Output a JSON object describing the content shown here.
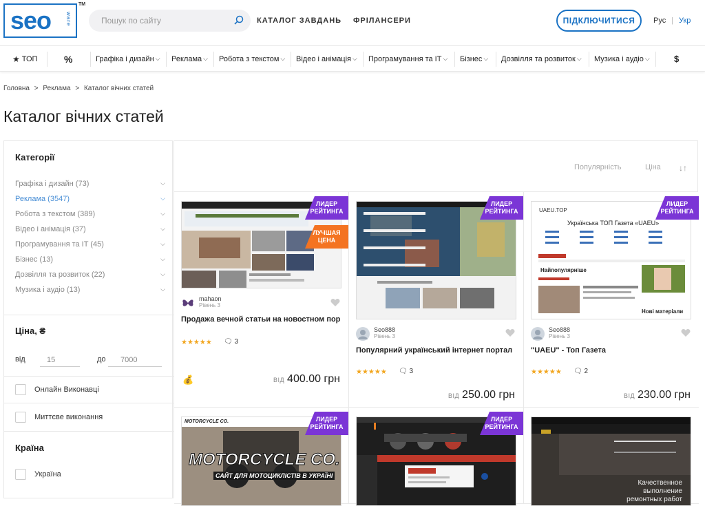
{
  "logo": {
    "main": "seo",
    "side": "ware",
    "tm": "TM"
  },
  "search": {
    "placeholder": "Пошук по сайту"
  },
  "topnav": {
    "catalog": "КАТАЛОГ ЗАВДАНЬ",
    "freelancers": "ФРІЛАНСЕРИ"
  },
  "connect_label": "ПІДКЛЮЧИТИСЯ",
  "lang": {
    "ru": "Рус",
    "sep": "|",
    "uk": "Укр"
  },
  "catbar": {
    "top_label": "ТОП",
    "percent_label": "%",
    "dollar_label": "$",
    "items": [
      "Графіка і дизайн",
      "Реклама",
      "Робота з текстом",
      "Відео і анімація",
      "Програмування та IT",
      "Бізнес",
      "Дозвілля та розвиток",
      "Музика і аудіо"
    ]
  },
  "breadcrumb": [
    "Головна",
    ">",
    "Реклама",
    ">",
    "Каталог вічних статей"
  ],
  "page_title": "Каталог вічних статей",
  "sidebar": {
    "categories_title": "Категорії",
    "categories": [
      {
        "label": "Графіка і дизайн (73)"
      },
      {
        "label": "Реклама (3547)"
      },
      {
        "label": "Робота з текстом (389)"
      },
      {
        "label": "Відео і анімація (37)"
      },
      {
        "label": "Програмування та IT (45)"
      },
      {
        "label": "Бізнес (13)"
      },
      {
        "label": "Дозвілля та розвиток (22)"
      },
      {
        "label": "Музика і аудіо (13)"
      }
    ],
    "price_title": "Ціна, ₴",
    "price_from_label": "від",
    "price_from": "15",
    "price_to_label": "до",
    "price_to": "7000",
    "online_label": "Онлайн Виконавці",
    "instant_label": "Миттєве виконання",
    "country_title": "Країна",
    "country_option": "Україна"
  },
  "sort": {
    "popularity": "Популярність",
    "price": "Ціна",
    "order_icon": "↓↑"
  },
  "cards": [
    {
      "ribbon": "ЛИДЕР РЕЙТИНГА",
      "ribbon2": "ЛУЧШАЯ ЦЕНА",
      "seller": "mahaon",
      "level": "Рівень 3",
      "title": "Продажа вечной статьи на новостном пор",
      "stars": "★★★★★",
      "comments": "3",
      "price_prefix": "ВІД",
      "price": "400.00 грн"
    },
    {
      "ribbon": "ЛИДЕР РЕЙТИНГА",
      "seller": "Seo888",
      "level": "Рівень 3",
      "title": "Популярний український інтернет портал",
      "stars": "★★★★★",
      "comments": "3",
      "price_prefix": "ВІД",
      "price": "250.00 грн"
    },
    {
      "ribbon": "ЛИДЕР РЕЙТИНГА",
      "seller": "Seo888",
      "level": "Рівень 3",
      "title": "\"UAEU\" - Топ Газета",
      "stars": "★★★★★",
      "comments": "2",
      "price_prefix": "ВІД",
      "price": "230.00 грн",
      "img_site": "UAEU.TOP",
      "img_heading": "Українська ТОП Газета «UAEU»",
      "img_popular": "Найпопулярніше",
      "img_new": "Нові матеріали"
    },
    {
      "ribbon": "ЛИДЕР РЕЙТИНГА",
      "img_brand": "MOTORCYCLE CO.",
      "img_tagline": "САЙТ ДЛЯ МОТОЦИКЛІСТІВ В УКРАЇНІ"
    },
    {
      "ribbon": "ЛИДЕР РЕЙТИНГА"
    },
    {
      "img_caption": "Качественное выполнение ремонтных работ"
    }
  ],
  "colors": {
    "accent": "#1a72c4",
    "ribbon": "#7b35d6",
    "best_price": "#f47321",
    "stars": "#f2a61f"
  }
}
